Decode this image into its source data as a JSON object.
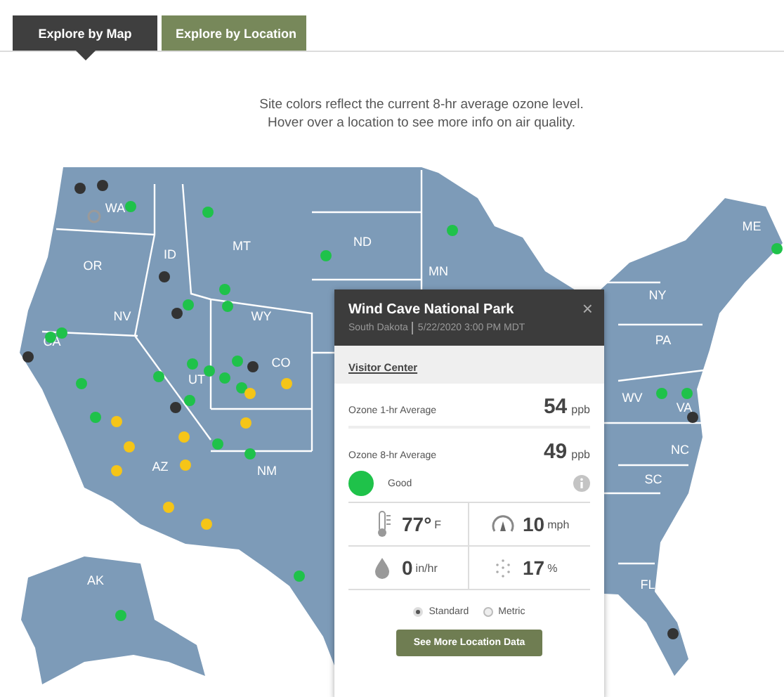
{
  "tabs": [
    {
      "label": "Explore by Map",
      "selected": true
    },
    {
      "label": "Explore by Location",
      "selected": false
    }
  ],
  "caption": [
    "Site colors reflect the current 8-hr average ozone level.",
    "Hover over a location to see more info on air quality."
  ],
  "map": {
    "state_labels": [
      "WA",
      "OR",
      "CA",
      "NV",
      "ID",
      "MT",
      "WY",
      "UT",
      "AZ",
      "CO",
      "NM",
      "ND",
      "MN",
      "NY",
      "PA",
      "ME",
      "WV",
      "VA",
      "NC",
      "SC",
      "FL",
      "AK"
    ],
    "sites": [
      {
        "color": "#333333"
      },
      {
        "color": "#333333"
      },
      {
        "color": "#9a9a9a"
      },
      {
        "color": "#1fc24a"
      },
      {
        "color": "#333333"
      },
      {
        "color": "#333333"
      },
      {
        "color": "#1fc24a"
      },
      {
        "color": "#1fc24a"
      },
      {
        "color": "#1fc24a"
      },
      {
        "color": "#1fc24a"
      },
      {
        "color": "#1fc24a"
      },
      {
        "color": "#333333"
      },
      {
        "color": "#1fc24a"
      },
      {
        "color": "#1fc24a"
      },
      {
        "color": "#f5c518"
      },
      {
        "color": "#f5c518"
      },
      {
        "color": "#f5c518"
      },
      {
        "color": "#1fc24a"
      },
      {
        "color": "#1fc24a"
      },
      {
        "color": "#1fc24a"
      },
      {
        "color": "#1fc24a"
      },
      {
        "color": "#1fc24a"
      },
      {
        "color": "#333333"
      },
      {
        "color": "#1fc24a"
      },
      {
        "color": "#333333"
      },
      {
        "color": "#1fc24a"
      },
      {
        "color": "#f5c518"
      },
      {
        "color": "#f5c518"
      },
      {
        "color": "#f5c518"
      },
      {
        "color": "#f5c518"
      },
      {
        "color": "#f5c518"
      },
      {
        "color": "#1fc24a"
      },
      {
        "color": "#1fc24a"
      },
      {
        "color": "#f5c518"
      },
      {
        "color": "#f5c518"
      },
      {
        "color": "#1fc24a"
      },
      {
        "color": "#1fc24a"
      },
      {
        "color": "#1fc24a"
      },
      {
        "color": "#1fc24a"
      },
      {
        "color": "#1fc24a"
      },
      {
        "color": "#1fc24a"
      },
      {
        "color": "#1fc24a"
      },
      {
        "color": "#333333"
      },
      {
        "color": "#333333"
      },
      {
        "color": "#1fc24a"
      }
    ]
  },
  "popup": {
    "title": "Wind Cave National Park",
    "close": "×",
    "state": "South Dakota",
    "time": "5/22/2020 3:00 PM MDT",
    "location_link": "Visitor Center",
    "readings": [
      {
        "label": "Ozone 1-hr Average",
        "value": "54",
        "unit": "ppb"
      },
      {
        "label": "Ozone 8-hr Average",
        "value": "49",
        "unit": "ppb"
      }
    ],
    "status": {
      "label": "Good",
      "color": "#1fc24a"
    },
    "weather": [
      {
        "kind": "temperature",
        "value": "77°",
        "unit": "F"
      },
      {
        "kind": "wind",
        "value": "10",
        "unit": "mph"
      },
      {
        "kind": "rain",
        "value": "0",
        "unit": "in/hr"
      },
      {
        "kind": "humidity",
        "value": "17",
        "unit": "%"
      }
    ],
    "units": [
      {
        "label": "Standard",
        "selected": true
      },
      {
        "label": "Metric",
        "selected": false
      }
    ],
    "button": "See More Location Data"
  }
}
